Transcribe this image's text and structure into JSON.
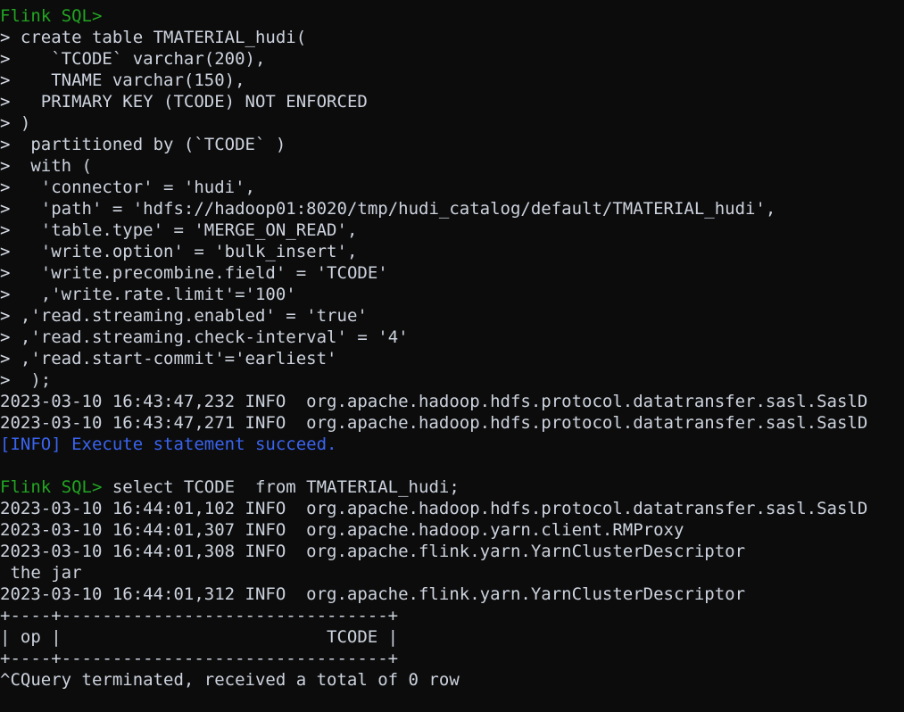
{
  "terminal": {
    "app": "Flink SQL Client",
    "background_color": "#0c0c0c",
    "foreground_color": "#cdd3de",
    "prompt_color": "#22a522",
    "info_color": "#3a64f0",
    "prompt_label": "Flink SQL>",
    "continuation_marker": ">"
  },
  "lines": [
    {
      "id": "l01",
      "kind": "prompt",
      "prompt": "Flink SQL>",
      "text": ""
    },
    {
      "id": "l02",
      "kind": "continuation",
      "marker": ">",
      "text": " create table TMATERIAL_hudi("
    },
    {
      "id": "l03",
      "kind": "continuation",
      "marker": ">",
      "text": "    `TCODE` varchar(200),"
    },
    {
      "id": "l04",
      "kind": "continuation",
      "marker": ">",
      "text": "    TNAME varchar(150),"
    },
    {
      "id": "l05",
      "kind": "continuation",
      "marker": ">",
      "text": "   PRIMARY KEY (TCODE) NOT ENFORCED"
    },
    {
      "id": "l06",
      "kind": "continuation",
      "marker": ">",
      "text": " )"
    },
    {
      "id": "l07",
      "kind": "continuation",
      "marker": ">",
      "text": "  partitioned by (`TCODE` )"
    },
    {
      "id": "l08",
      "kind": "continuation",
      "marker": ">",
      "text": "  with ("
    },
    {
      "id": "l09",
      "kind": "continuation",
      "marker": ">",
      "text": "   'connector' = 'hudi',"
    },
    {
      "id": "l10",
      "kind": "continuation",
      "marker": ">",
      "text": "   'path' = 'hdfs://hadoop01:8020/tmp/hudi_catalog/default/TMATERIAL_hudi',"
    },
    {
      "id": "l11",
      "kind": "continuation",
      "marker": ">",
      "text": "   'table.type' = 'MERGE_ON_READ',"
    },
    {
      "id": "l12",
      "kind": "continuation",
      "marker": ">",
      "text": "   'write.option' = 'bulk_insert',"
    },
    {
      "id": "l13",
      "kind": "continuation",
      "marker": ">",
      "text": "   'write.precombine.field' = 'TCODE'"
    },
    {
      "id": "l14",
      "kind": "continuation",
      "marker": ">",
      "text": "   ,'write.rate.limit'='100'"
    },
    {
      "id": "l15",
      "kind": "continuation",
      "marker": ">",
      "text": " ,'read.streaming.enabled' = 'true'"
    },
    {
      "id": "l16",
      "kind": "continuation",
      "marker": ">",
      "text": " ,'read.streaming.check-interval' = '4'"
    },
    {
      "id": "l17",
      "kind": "continuation",
      "marker": ">",
      "text": " ,'read.start-commit'='earliest'"
    },
    {
      "id": "l18",
      "kind": "continuation",
      "marker": ">",
      "text": "  );"
    },
    {
      "id": "l19",
      "kind": "log",
      "text": "2023-03-10 16:43:47,232 INFO  org.apache.hadoop.hdfs.protocol.datatransfer.sasl.SaslD"
    },
    {
      "id": "l20",
      "kind": "log",
      "text": "2023-03-10 16:43:47,271 INFO  org.apache.hadoop.hdfs.protocol.datatransfer.sasl.SaslD"
    },
    {
      "id": "l21",
      "kind": "info",
      "text": "[INFO] Execute statement succeed."
    },
    {
      "id": "l22",
      "kind": "blank",
      "text": ""
    },
    {
      "id": "l23",
      "kind": "command",
      "prompt": "Flink SQL>",
      "text": " select TCODE  from TMATERIAL_hudi;"
    },
    {
      "id": "l24",
      "kind": "log",
      "text": "2023-03-10 16:44:01,102 INFO  org.apache.hadoop.hdfs.protocol.datatransfer.sasl.SaslD"
    },
    {
      "id": "l25",
      "kind": "log",
      "text": "2023-03-10 16:44:01,307 INFO  org.apache.hadoop.yarn.client.RMProxy"
    },
    {
      "id": "l26",
      "kind": "log",
      "text": "2023-03-10 16:44:01,308 INFO  org.apache.flink.yarn.YarnClusterDescriptor"
    },
    {
      "id": "l27",
      "kind": "log",
      "text": " the jar"
    },
    {
      "id": "l28",
      "kind": "log",
      "text": "2023-03-10 16:44:01,312 INFO  org.apache.flink.yarn.YarnClusterDescriptor"
    },
    {
      "id": "l29",
      "kind": "table-border",
      "text": "+----+--------------------------------+"
    },
    {
      "id": "l30",
      "kind": "table-row",
      "text": "| op |                          TCODE |"
    },
    {
      "id": "l31",
      "kind": "table-border",
      "text": "+----+--------------------------------+"
    },
    {
      "id": "l32",
      "kind": "status",
      "text": "^CQuery terminated, received a total of 0 row"
    }
  ],
  "result_table": {
    "columns": [
      "op",
      "TCODE"
    ],
    "rows": [],
    "row_count": 0,
    "border_top": "+----+--------------------------------+",
    "header_row": "| op |                          TCODE |",
    "border_bottom": "+----+--------------------------------+"
  },
  "statements": {
    "create_table": {
      "table_name": "TMATERIAL_hudi",
      "columns": [
        {
          "name": "TCODE",
          "type": "varchar(200)"
        },
        {
          "name": "TNAME",
          "type": "varchar(150)"
        }
      ],
      "primary_key": "PRIMARY KEY (TCODE) NOT ENFORCED",
      "partitioned_by": "`TCODE`",
      "options": [
        {
          "key": "connector",
          "value": "hudi"
        },
        {
          "key": "path",
          "value": "hdfs://hadoop01:8020/tmp/hudi_catalog/default/TMATERIAL_hudi"
        },
        {
          "key": "table.type",
          "value": "MERGE_ON_READ"
        },
        {
          "key": "write.option",
          "value": "bulk_insert"
        },
        {
          "key": "write.precombine.field",
          "value": "TCODE"
        },
        {
          "key": "write.rate.limit",
          "value": "100"
        },
        {
          "key": "read.streaming.enabled",
          "value": "true"
        },
        {
          "key": "read.streaming.check-interval",
          "value": "4"
        },
        {
          "key": "read.start-commit",
          "value": "earliest"
        }
      ]
    },
    "select": "select TCODE  from TMATERIAL_hudi;"
  }
}
